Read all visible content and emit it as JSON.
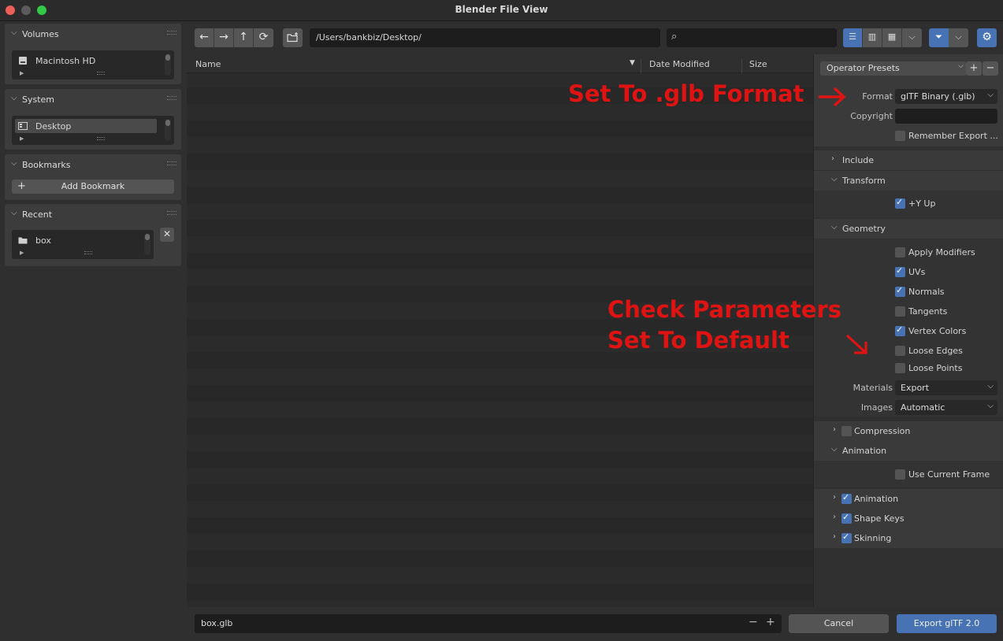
{
  "window": {
    "title": "Blender File View"
  },
  "sidebar": {
    "volumes": {
      "title": "Volumes",
      "items": [
        "Macintosh HD"
      ]
    },
    "system": {
      "title": "System",
      "items": [
        "Desktop"
      ]
    },
    "bookmarks": {
      "title": "Bookmarks",
      "add_label": "Add Bookmark"
    },
    "recent": {
      "title": "Recent",
      "items": [
        "box"
      ]
    }
  },
  "toolbar": {
    "path": "/Users/bankbiz/Desktop/",
    "search_value": ""
  },
  "filelist": {
    "columns": [
      "Name",
      "Date Modified",
      "Size"
    ]
  },
  "settings": {
    "preset_label": "Operator Presets",
    "format_label": "Format",
    "format_value": "glTF Binary (.glb)",
    "copyright_label": "Copyright",
    "copyright_value": "",
    "remember_label": "Remember Export ...",
    "include_label": "Include",
    "transform_label": "Transform",
    "y_up_label": "+Y Up",
    "geometry_label": "Geometry",
    "apply_modifiers": "Apply Modifiers",
    "uvs": "UVs",
    "normals": "Normals",
    "tangents": "Tangents",
    "vertex_colors": "Vertex Colors",
    "loose_edges": "Loose Edges",
    "loose_points": "Loose Points",
    "materials_label": "Materials",
    "materials_value": "Export",
    "images_label": "Images",
    "images_value": "Automatic",
    "compression_label": "Compression",
    "animation_section_label": "Animation",
    "use_current_frame": "Use Current Frame",
    "animation_label": "Animation",
    "shape_keys_label": "Shape Keys",
    "skinning_label": "Skinning",
    "checked": {
      "remember": false,
      "y_up": true,
      "apply_modifiers": false,
      "uvs": true,
      "normals": true,
      "tangents": false,
      "vertex_colors": true,
      "loose_edges": false,
      "loose_points": false,
      "compression": false,
      "use_current_frame": false,
      "animation": true,
      "shape_keys": true,
      "skinning": true
    }
  },
  "annotations": {
    "format_note": "Set To .glb Format",
    "params_line1": "Check Parameters",
    "params_line2": "Set To Default",
    "color": "#e01313"
  },
  "bottom": {
    "filename": "box.glb",
    "cancel_label": "Cancel",
    "export_label": "Export glTF 2.0"
  },
  "colors": {
    "accent": "#4772b3"
  }
}
